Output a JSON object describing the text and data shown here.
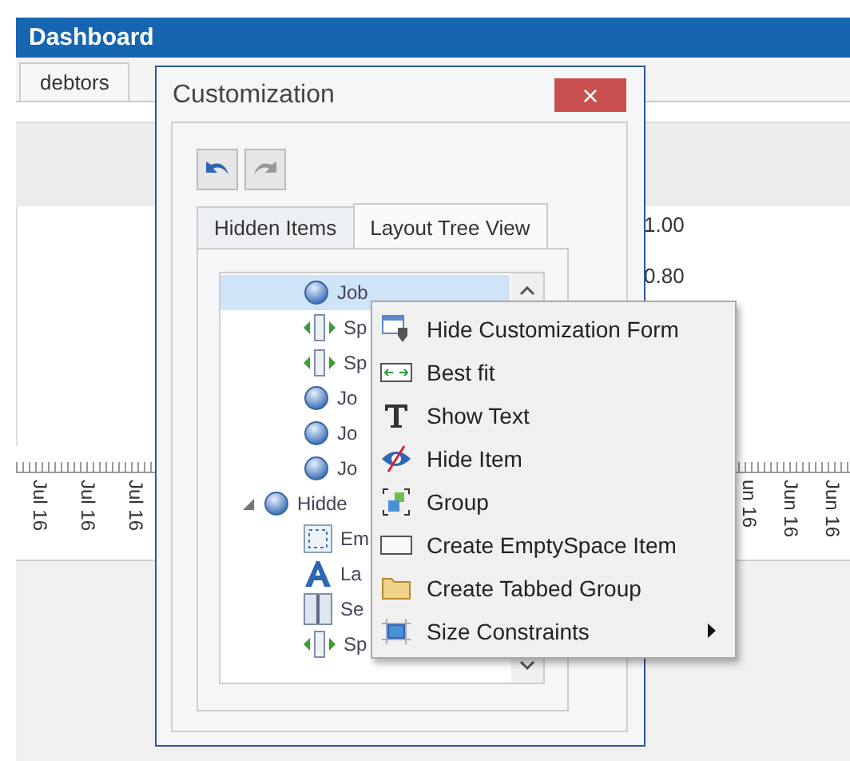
{
  "dashboard": {
    "title": "Dashboard",
    "tabs": [
      {
        "label": "debtors"
      }
    ],
    "chart": {
      "y_labels": [
        "1.00",
        "0.80"
      ],
      "x_labels_left": [
        "Jul 16",
        "Jul 16",
        "Jul 16"
      ],
      "x_labels_right": [
        "un 16",
        "Jun 16",
        "Jun 16"
      ]
    }
  },
  "dialog": {
    "title": "Customization",
    "close": "×",
    "tabs": [
      {
        "label": "Hidden Items",
        "selected": false
      },
      {
        "label": "Layout Tree View",
        "selected": true
      }
    ],
    "tree": [
      {
        "kind": "item",
        "label": "Job",
        "selected": true
      },
      {
        "kind": "splitter",
        "label": "Sp",
        "selected": false
      },
      {
        "kind": "splitter",
        "label": "Sp",
        "selected": false
      },
      {
        "kind": "item",
        "label": "Jo",
        "selected": false
      },
      {
        "kind": "item",
        "label": "Jo",
        "selected": false
      },
      {
        "kind": "item",
        "label": "Jo",
        "selected": false
      },
      {
        "kind": "item",
        "label": "Hidde",
        "selected": false,
        "expanded": true,
        "children": [
          {
            "kind": "empty",
            "label": "Em",
            "selected": false
          },
          {
            "kind": "label",
            "label": "La",
            "selected": false
          },
          {
            "kind": "separator",
            "label": "Se",
            "selected": false
          },
          {
            "kind": "splitter",
            "label": "Sp",
            "selected": false
          }
        ]
      }
    ]
  },
  "context_menu": [
    {
      "kind": "hide-form",
      "label": "Hide Customization Form",
      "submenu": false
    },
    {
      "kind": "best-fit",
      "label": "Best fit",
      "submenu": false
    },
    {
      "kind": "text",
      "label": "Show Text",
      "submenu": false
    },
    {
      "kind": "hide",
      "label": "Hide Item",
      "submenu": false
    },
    {
      "kind": "group",
      "label": "Group",
      "submenu": false
    },
    {
      "kind": "empty",
      "label": "Create EmptySpace Item",
      "submenu": false
    },
    {
      "kind": "tabbed",
      "label": "Create Tabbed Group",
      "submenu": false
    },
    {
      "kind": "size",
      "label": "Size Constraints",
      "submenu": true
    }
  ]
}
